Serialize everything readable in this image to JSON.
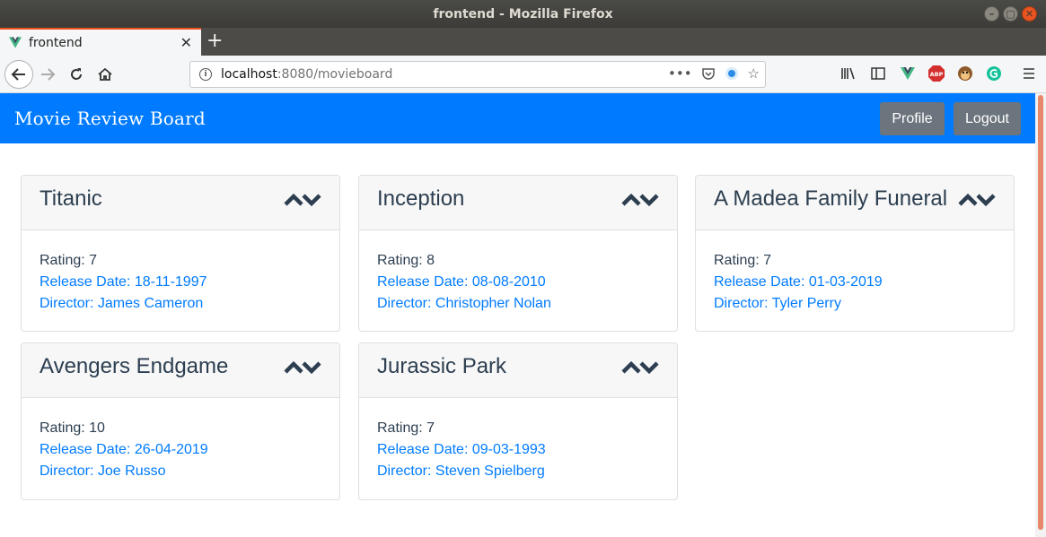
{
  "window": {
    "title": "frontend - Mozilla Firefox",
    "buttons": [
      "–",
      "▢",
      "✕"
    ]
  },
  "browser": {
    "tab_title": "frontend",
    "url_host": "localhost",
    "url_path": ":8080/movieboard",
    "url_more": "•••",
    "ext_abp": "ABP"
  },
  "app": {
    "brand": "Movie Review Board",
    "profile_label": "Profile",
    "logout_label": "Logout"
  },
  "movies": [
    {
      "title": "Titanic",
      "rating": "Rating: 7",
      "release": "Release Date: 18-11-1997",
      "director": "Director: James Cameron"
    },
    {
      "title": "Inception",
      "rating": "Rating: 8",
      "release": "Release Date: 08-08-2010",
      "director": "Director: Christopher Nolan"
    },
    {
      "title": "A Madea Family Funeral",
      "rating": "Rating: 7",
      "release": "Release Date: 01-03-2019",
      "director": "Director: Tyler Perry"
    },
    {
      "title": "Avengers Endgame",
      "rating": "Rating: 10",
      "release": "Release Date: 26-04-2019",
      "director": "Director: Joe Russo"
    },
    {
      "title": "Jurassic Park",
      "rating": "Rating: 7",
      "release": "Release Date: 09-03-1993",
      "director": "Director: Steven Spielberg"
    }
  ],
  "colors": {
    "accent": "#007bff",
    "button": "#6c757d",
    "text": "#2c3e50"
  }
}
